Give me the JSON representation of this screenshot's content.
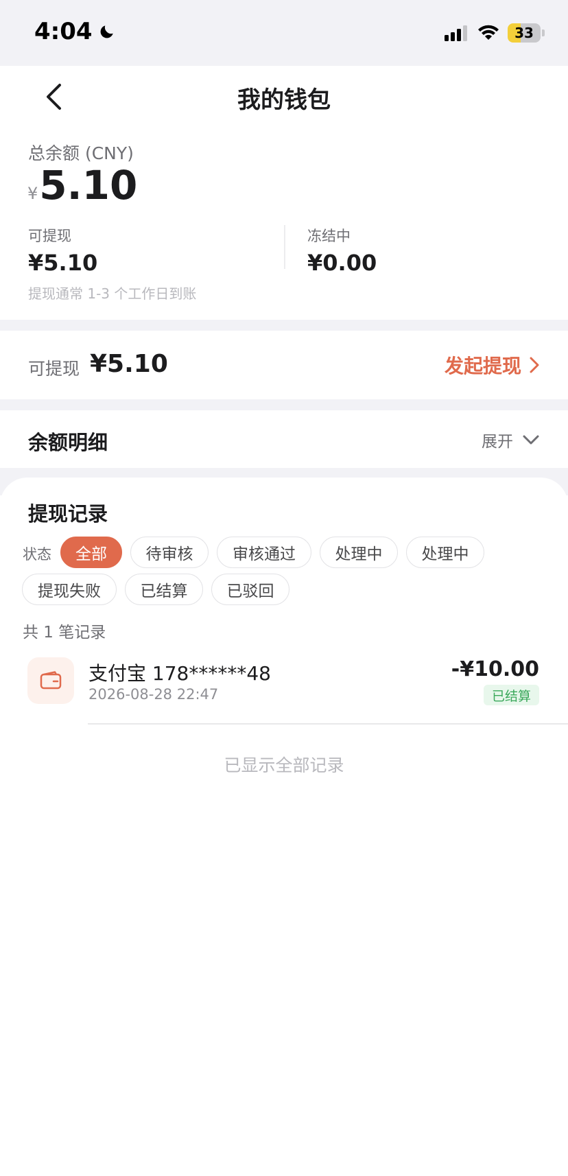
{
  "status_bar": {
    "time": "4:04",
    "battery": "33"
  },
  "nav": {
    "title": "我的钱包"
  },
  "balance": {
    "total_label": "总余额 (CNY)",
    "currency_symbol": "¥",
    "total_value": "5.10",
    "available_label": "可提现",
    "available_value": "¥5.10",
    "frozen_label": "冻结中",
    "frozen_value": "¥0.00",
    "note": "提现通常 1-3 个工作日到账"
  },
  "withdraw": {
    "label": "可提现",
    "value": "¥5.10",
    "action_label": "发起提现"
  },
  "detail": {
    "title": "余额明细",
    "toggle_label": "展开"
  },
  "records": {
    "title": "提现记录",
    "status_label": "状态",
    "filters": [
      "全部",
      "待审核",
      "审核通过",
      "处理中",
      "处理中",
      "提现失败",
      "已结算",
      "已驳回"
    ],
    "active_filter": "全部",
    "count_text": "共 1 笔记录",
    "items": [
      {
        "title": "支付宝 178******48",
        "time": "2026-08-28 22:47",
        "amount": "-¥10.00",
        "status": "已结算",
        "icon": "wallet-icon"
      }
    ],
    "end_note": "已显示全部记录"
  },
  "colors": {
    "accent": "#e06a4c",
    "success_text": "#3aa85a",
    "success_bg": "#e8f7ec",
    "page_gap": "#f2f2f6"
  }
}
